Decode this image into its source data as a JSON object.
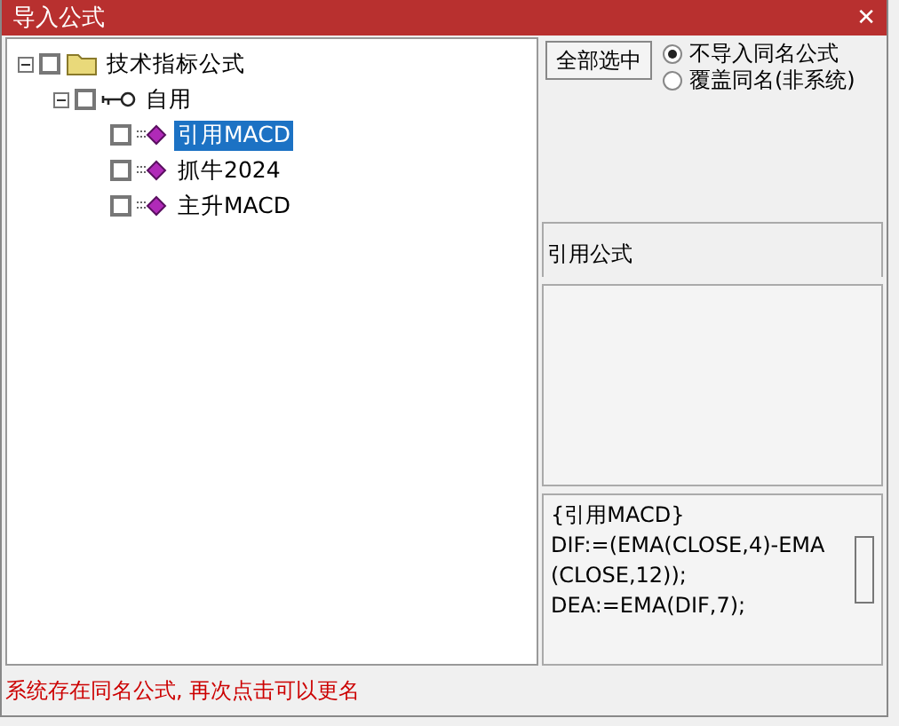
{
  "window": {
    "title": "导入公式",
    "close": "✕"
  },
  "tree": [
    {
      "label": "技术指标公式",
      "kind": "folder",
      "expanded": true,
      "checked": false,
      "selected": false,
      "children": [
        {
          "label": "自用",
          "kind": "key",
          "expanded": true,
          "checked": false,
          "selected": false,
          "children": [
            {
              "label": "引用MACD",
              "kind": "formula",
              "checked": false,
              "selected": true
            },
            {
              "label": "抓牛2024",
              "kind": "formula",
              "checked": false,
              "selected": false
            },
            {
              "label": "主升MACD",
              "kind": "formula",
              "checked": false,
              "selected": false
            }
          ]
        }
      ]
    }
  ],
  "select_all_button": "全部选中",
  "options": [
    {
      "label": "不导入同名公式",
      "selected": true
    },
    {
      "label": "覆盖同名(非系统)",
      "selected": false
    }
  ],
  "formula_name_field": {
    "value": "引用公式"
  },
  "formula_source": {
    "lines": [
      "{引用MACD}",
      "DIF:=(EMA(CLOSE,4)-EMA",
      "(CLOSE,12));",
      "DEA:=EMA(DIF,7);"
    ]
  },
  "status_bar": "系统存在同名公式, 再次点击可以更名"
}
